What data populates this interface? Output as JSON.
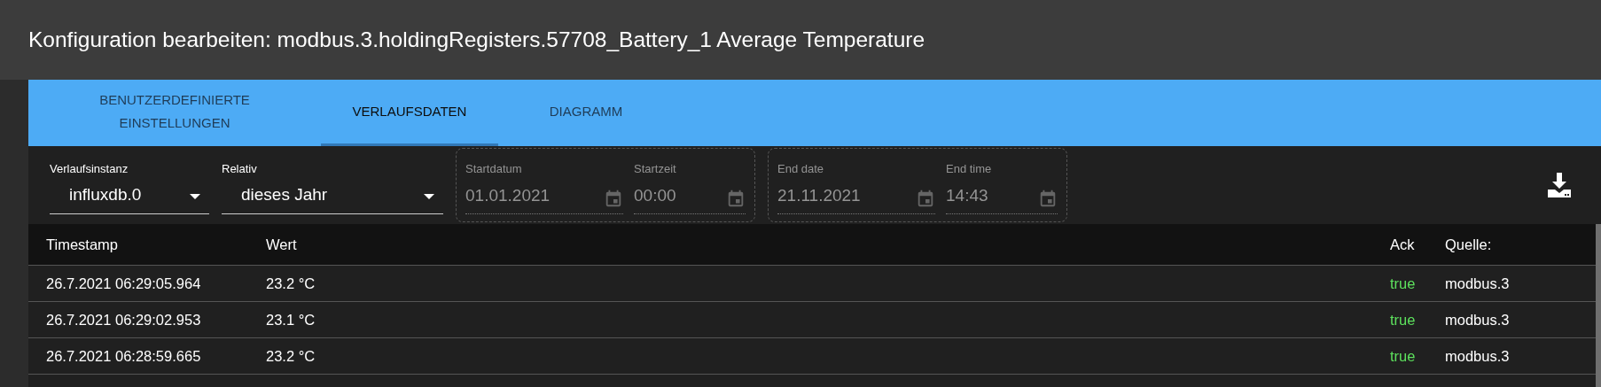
{
  "dialog": {
    "title": "Konfiguration bearbeiten: modbus.3.holdingRegisters.57708_Battery_1 Average Temperature"
  },
  "tabs": [
    {
      "label": "BENUTZERDEFINIERTE EINSTELLUNGEN",
      "selected": false
    },
    {
      "label": "VERLAUFSDATEN",
      "selected": true
    },
    {
      "label": "DIAGRAMM",
      "selected": false
    }
  ],
  "selects": [
    {
      "label": "Verlaufsinstanz",
      "value": "influxdb.0"
    },
    {
      "label": "Relativ",
      "value": "dieses Jahr"
    }
  ],
  "range_groups": [
    {
      "disabled": true,
      "fields": [
        {
          "kind": "date",
          "label": "Startdatum",
          "value": "01.01.2021"
        },
        {
          "kind": "time",
          "label": "Startzeit",
          "value": "00:00"
        }
      ]
    },
    {
      "disabled": true,
      "fields": [
        {
          "kind": "date",
          "label": "End date",
          "value": "21.11.2021"
        },
        {
          "kind": "time",
          "label": "End time",
          "value": "14:43"
        }
      ]
    }
  ],
  "table": {
    "columns": [
      "Timestamp",
      "Wert",
      "Ack",
      "Quelle:"
    ],
    "rows": [
      [
        "26.7.2021 06:29:05.964",
        "23.2 °C",
        "true",
        "modbus.3"
      ],
      [
        "26.7.2021 06:29:02.953",
        "23.1 °C",
        "true",
        "modbus.3"
      ],
      [
        "26.7.2021 06:28:59.665",
        "23.2 °C",
        "true",
        "modbus.3"
      ]
    ]
  }
}
